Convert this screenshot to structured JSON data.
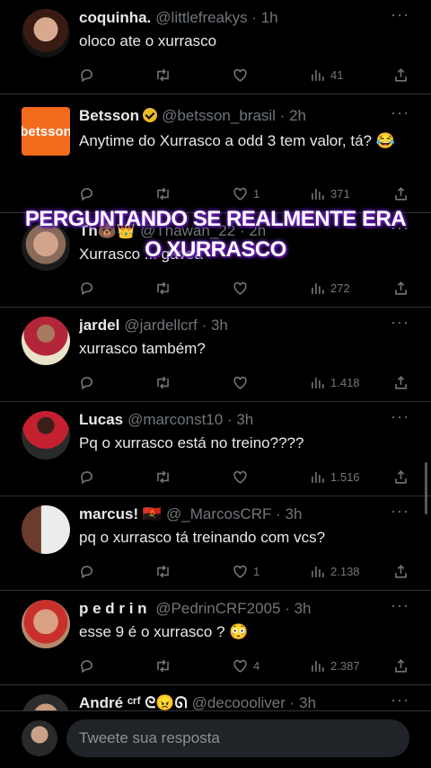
{
  "colors": {
    "background": "#000000",
    "text": "#e7e9ea",
    "muted": "#71767b",
    "divider": "#2f3336",
    "overlay_glow": "#7b2bd6"
  },
  "icons": {
    "reply": "reply-icon",
    "retweet": "retweet-icon",
    "like": "heart-icon",
    "views": "views-icon",
    "share": "share-icon",
    "more": "more-icon"
  },
  "overlay": {
    "line1": "PERGUNTANDO SE REALMENTE ERA",
    "line2": "O XURRASCO"
  },
  "tweets": [
    {
      "name": "coquinha.",
      "handle": "@littlefreakys",
      "time": "· 1h",
      "text": "oloco ate o xurrasco",
      "likes": "",
      "views": "41"
    },
    {
      "name": "Betsson",
      "handle": "@betsson_brasil",
      "time": "· 2h",
      "text": "Anytime do Xurrasco a odd 3 tem valor, tá? 😂",
      "likes": "1",
      "views": "371",
      "avatar_text": "betsson"
    },
    {
      "name": "Th🐻👑",
      "handle": "@Thawan_22",
      "time": "· 2h",
      "text": "Xurrasco ... gávea",
      "likes": "",
      "views": "272"
    },
    {
      "name": "jardel",
      "handle": "@jardellcrf",
      "time": "· 3h",
      "text": "xurrasco também?",
      "likes": "",
      "views": "1.418"
    },
    {
      "name": "Lucas",
      "handle": "@marconst10",
      "time": "· 3h",
      "text": "Pq o xurrasco está no treino????",
      "likes": "",
      "views": "1.516"
    },
    {
      "name": "marcus! 🇦🇴",
      "handle": "@_MarcosCRF",
      "time": "· 3h",
      "text": "pq o xurrasco tá treinando com vcs?",
      "likes": "1",
      "views": "2.138"
    },
    {
      "name": "p e d r i n ",
      "handle": "@PedrinCRF2005",
      "time": "· 3h",
      "text": "esse 9 é o xurrasco ? 😳",
      "likes": "4",
      "views": "2.387"
    },
    {
      "name": "André ᶜʳᶠ ᘓ😠ᘏ",
      "handle": "@decoooliver",
      "time": "· 3h",
      "text": "",
      "likes": "",
      "views": ""
    }
  ],
  "composer": {
    "placeholder": "Tweete sua resposta"
  }
}
